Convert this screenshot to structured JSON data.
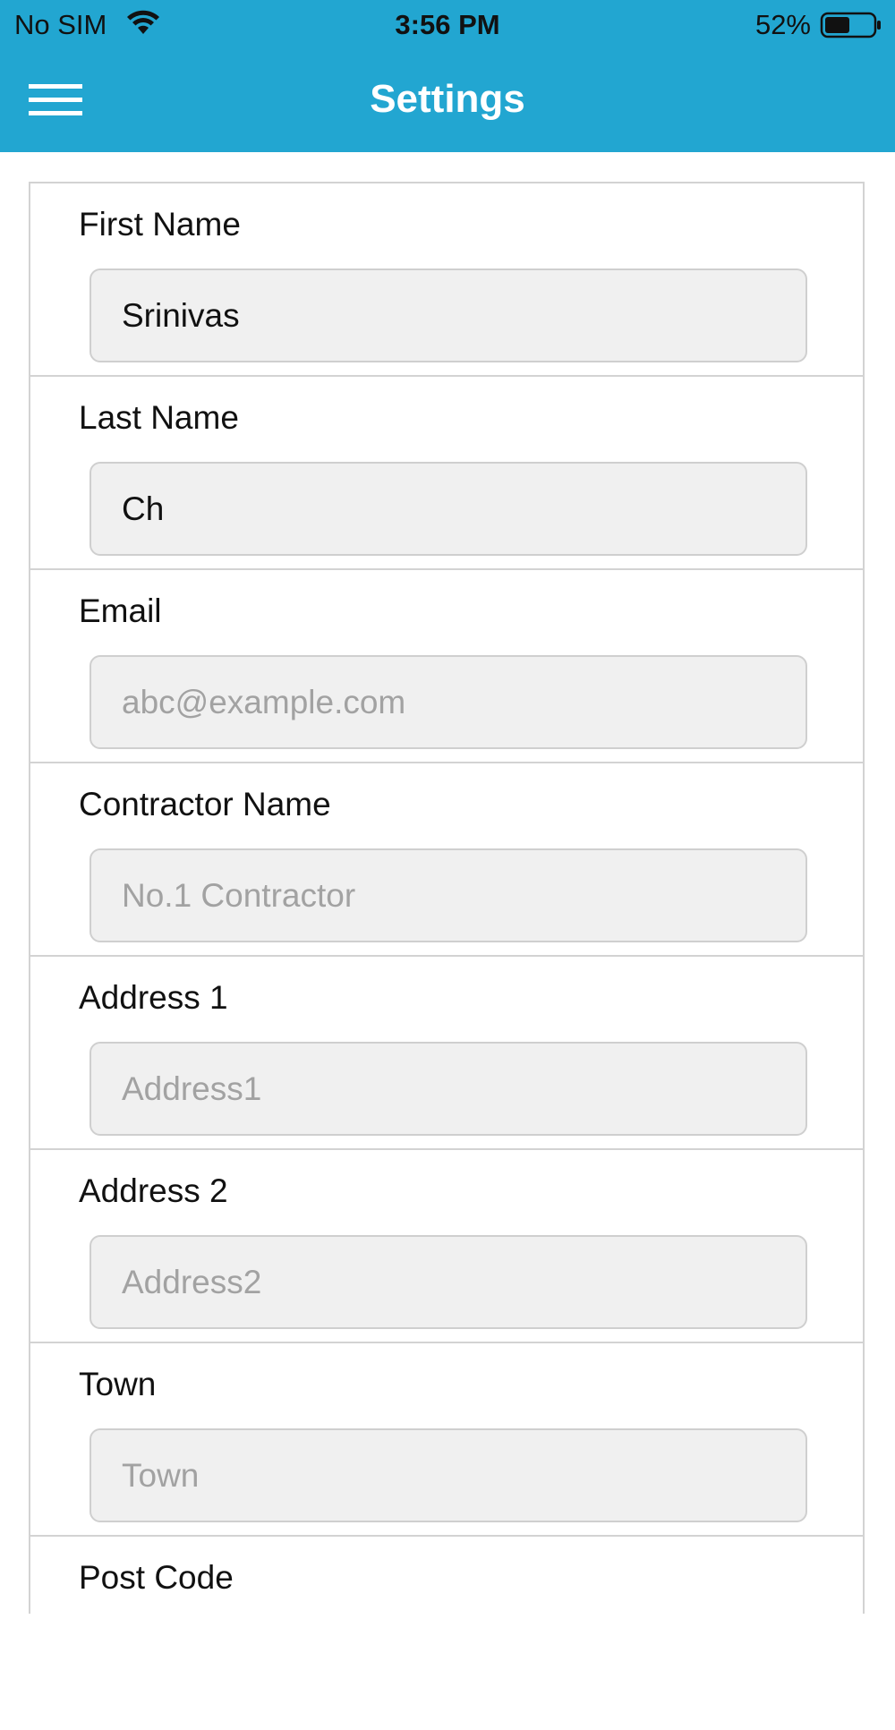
{
  "status_bar": {
    "carrier": "No SIM",
    "time": "3:56 PM",
    "battery_percent": "52%",
    "battery_level": 0.52,
    "wifi_icon": "wifi-icon",
    "battery_icon": "battery-icon"
  },
  "header": {
    "title": "Settings",
    "menu_icon": "hamburger-menu-icon",
    "background_color": "#22a6d1"
  },
  "form": {
    "fields": [
      {
        "label": "First Name",
        "value": "Srinivas",
        "placeholder": ""
      },
      {
        "label": "Last Name",
        "value": "Ch",
        "placeholder": ""
      },
      {
        "label": "Email",
        "value": "",
        "placeholder": "abc@example.com"
      },
      {
        "label": "Contractor Name",
        "value": "",
        "placeholder": "No.1 Contractor"
      },
      {
        "label": "Address 1",
        "value": "",
        "placeholder": "Address1"
      },
      {
        "label": "Address 2",
        "value": "",
        "placeholder": "Address2"
      },
      {
        "label": "Town",
        "value": "",
        "placeholder": "Town"
      },
      {
        "label": "Post Code",
        "value": "",
        "placeholder": ""
      }
    ]
  }
}
